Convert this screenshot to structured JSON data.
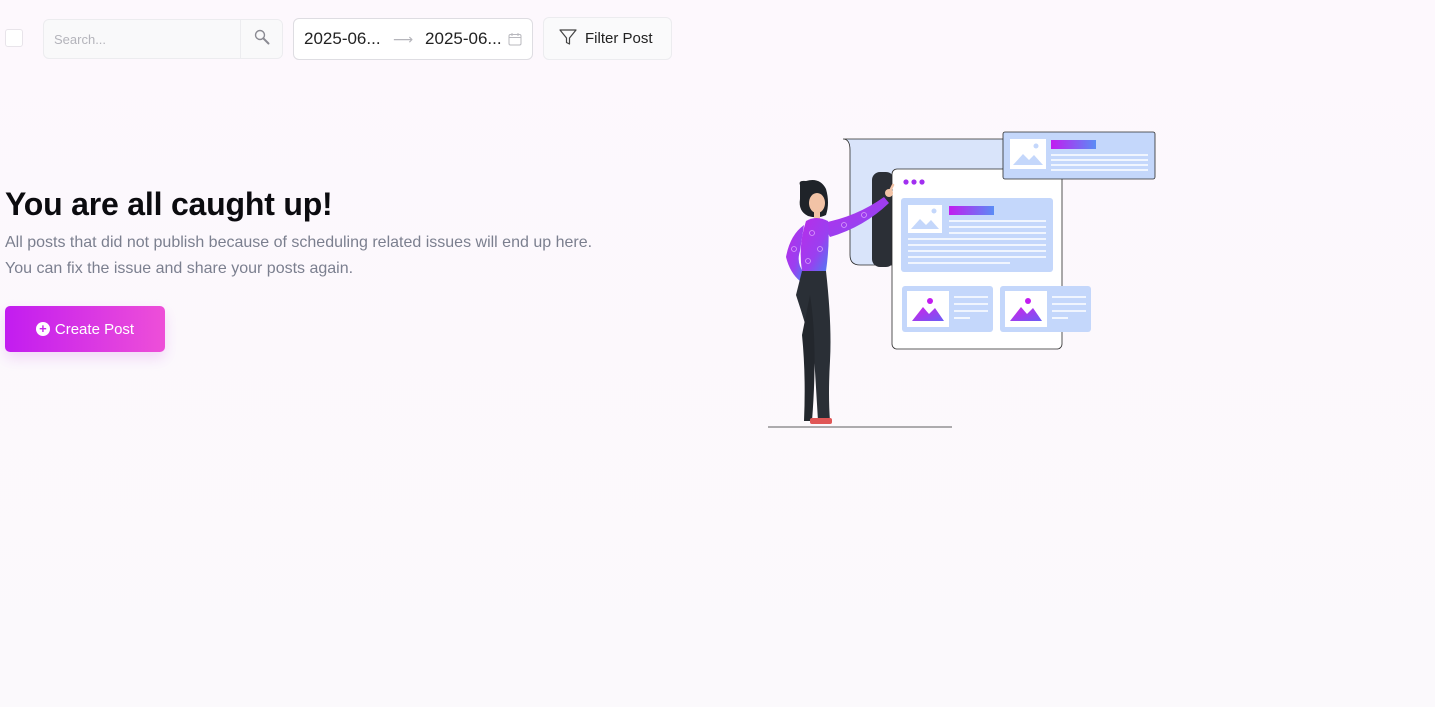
{
  "toolbar": {
    "search_placeholder": "Search...",
    "date_start": "2025-06...",
    "date_end": "2025-06...",
    "filter_label": "Filter Post"
  },
  "empty_state": {
    "title": "You are all caught up!",
    "description_line1": "All posts that did not publish because of scheduling related issues will end up here.",
    "description_line2": "You can fix the issue and share your posts again.",
    "create_button_label": "Create Post"
  },
  "icons": {
    "search": "search-icon",
    "calendar": "calendar-icon",
    "filter": "filter-icon",
    "plus": "plus-circle-icon"
  },
  "colors": {
    "accent_start": "#c21cf0",
    "accent_end": "#ee4fd8",
    "illustration_blue": "#c4d7fb"
  }
}
